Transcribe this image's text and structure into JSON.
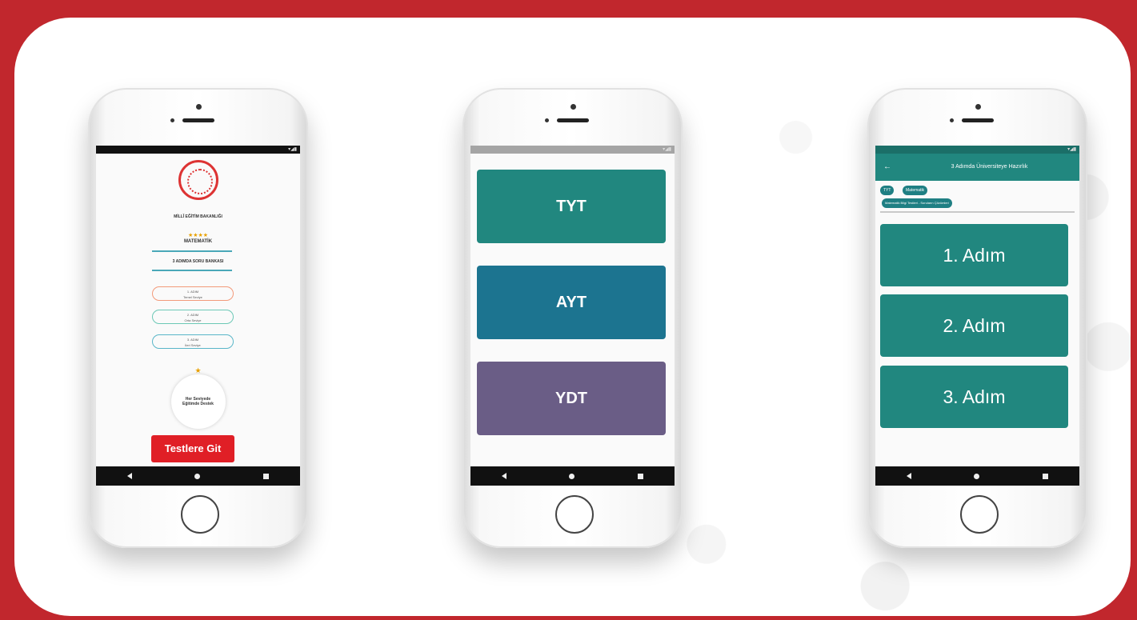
{
  "phone1": {
    "ministry_text": "MİLLÎ EĞİTİM BAKANLIĞI",
    "stars": "★★★★",
    "subject": "MATEMATİK",
    "book_title": "3 ADIMDA SORU BANKASI",
    "steps": [
      {
        "title": "1. ADIM",
        "subtitle": "Temel Seviye"
      },
      {
        "title": "2. ADIM",
        "subtitle": "Orta Seviye"
      },
      {
        "title": "3. ADIM",
        "subtitle": "İleri Seviye"
      }
    ],
    "circle_text": "Her Seviyede Eğitimde Destek",
    "goto_tests_button": "Testlere Git"
  },
  "phone2": {
    "buttons": [
      "TYT",
      "AYT",
      "YDT"
    ],
    "colors": [
      "#21877f",
      "#1c7490",
      "#6a5d86"
    ]
  },
  "phone3": {
    "appbar_title": "3 Adımda Üniversiteye Hazırlık",
    "chips": [
      "TYT",
      "Matematik",
      "Matematik Bilgi Testleri - Soruların Çözümleri"
    ],
    "steps": [
      "1. Adım",
      "2. Adım",
      "3. Adım"
    ]
  },
  "colors": {
    "frame_red": "#c1272d",
    "teal": "#21877f",
    "button_red": "#e01f26"
  }
}
